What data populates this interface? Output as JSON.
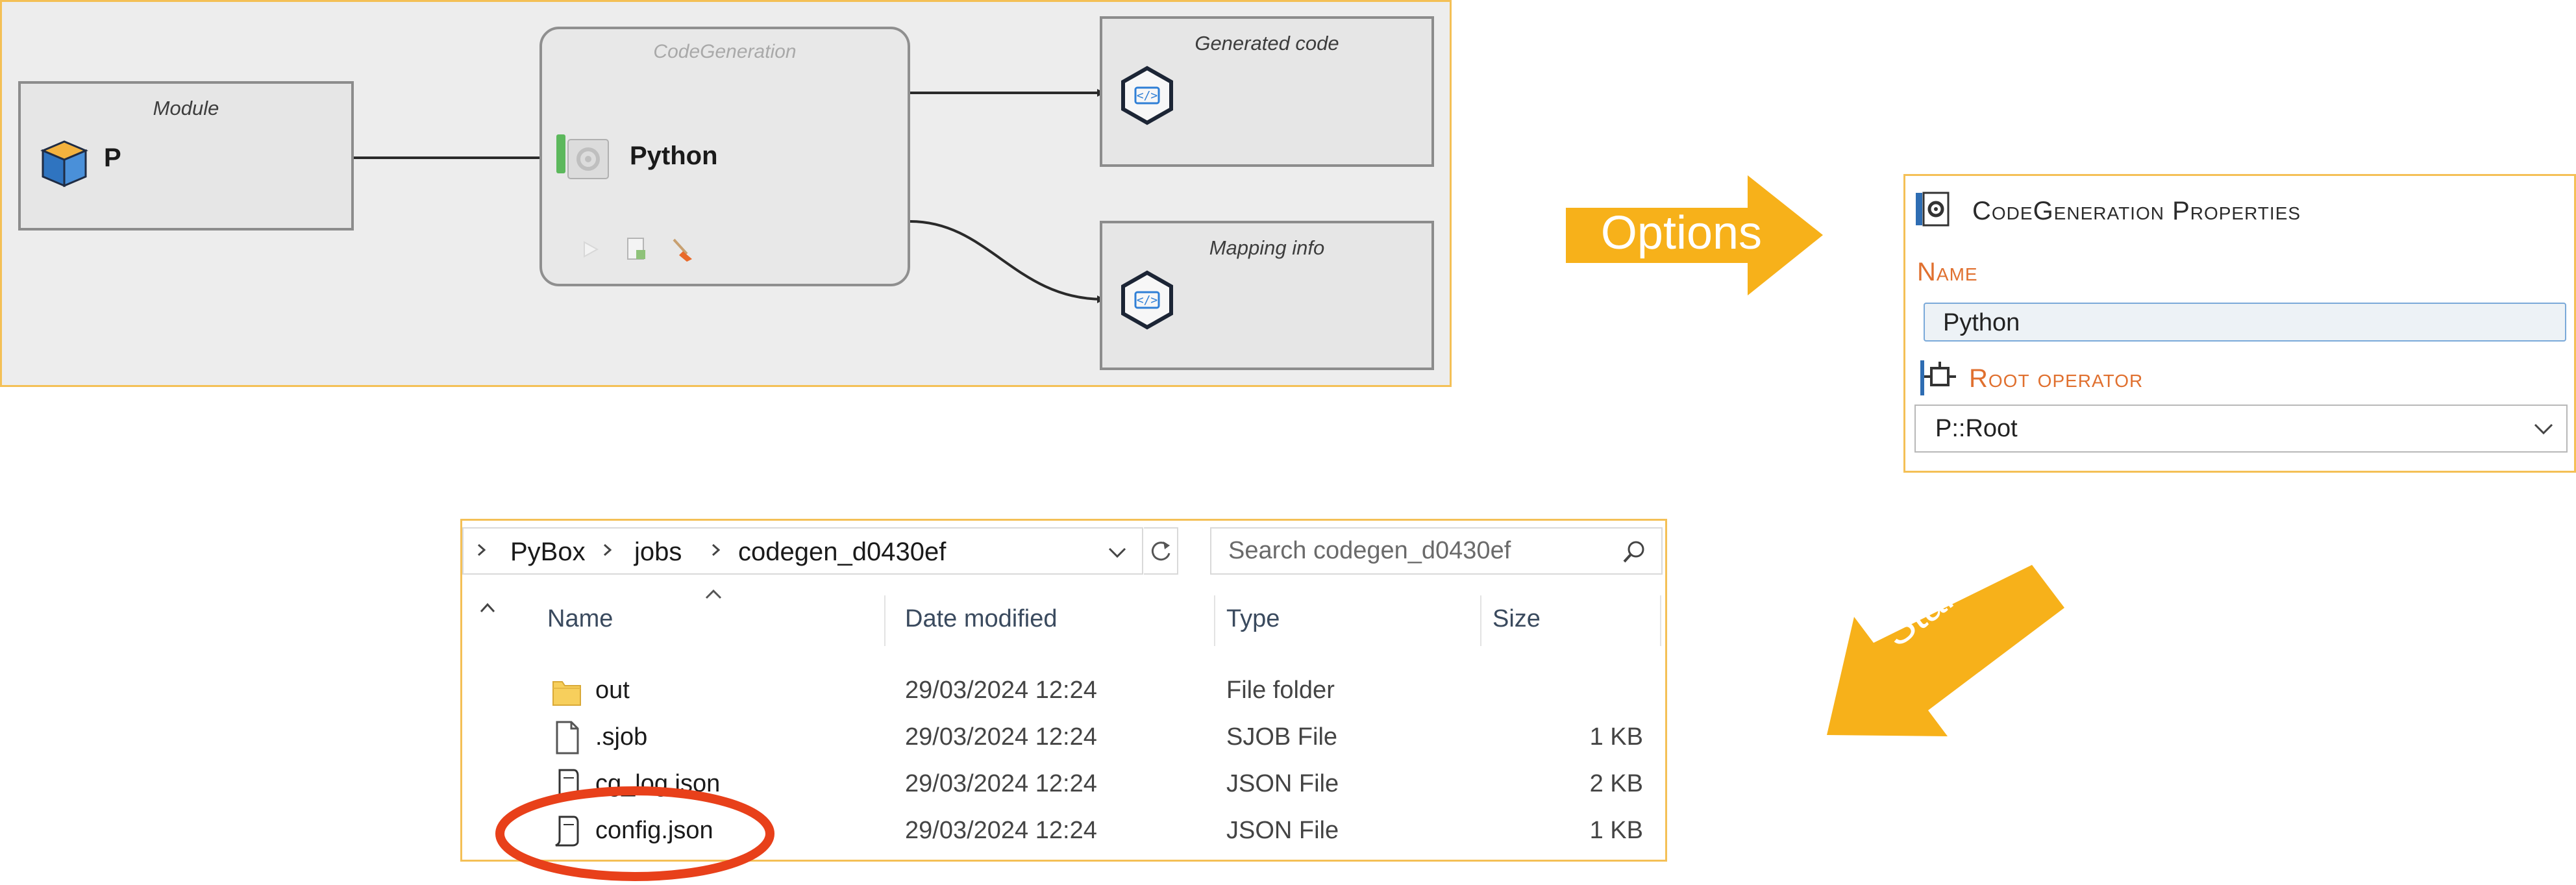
{
  "diagram": {
    "module": {
      "caption": "Module",
      "name": "P"
    },
    "codegen": {
      "caption": "CodeGeneration",
      "name": "Python"
    },
    "generated_code": {
      "caption": "Generated code"
    },
    "mapping_info": {
      "caption": "Mapping info"
    }
  },
  "arrows": {
    "options": {
      "label": "Options",
      "color": "#f7b11a"
    },
    "start": {
      "label": "Start",
      "color": "#f7b11a"
    }
  },
  "properties": {
    "title": "CodeGeneration Properties",
    "name_label": "Name",
    "name_value": "Python",
    "root_operator_label": "Root operator",
    "root_operator_value": "P::Root",
    "label_color": "#e0702f"
  },
  "explorer": {
    "breadcrumbs": [
      "PyBox",
      "jobs",
      "codegen_d0430ef"
    ],
    "search_placeholder": "Search codegen_d0430ef",
    "columns": [
      "Name",
      "Date modified",
      "Type",
      "Size"
    ],
    "files": [
      {
        "name": "out",
        "date": "29/03/2024 12:24",
        "type": "File folder",
        "size": "",
        "icon": "folder-icon"
      },
      {
        "name": ".sjob",
        "date": "29/03/2024 12:24",
        "type": "SJOB File",
        "size": "1 KB",
        "icon": "file-icon"
      },
      {
        "name": "cg_log.json",
        "date": "29/03/2024 12:24",
        "type": "JSON File",
        "size": "2 KB",
        "icon": "json-file-icon"
      },
      {
        "name": "config.json",
        "date": "29/03/2024 12:24",
        "type": "JSON File",
        "size": "1 KB",
        "icon": "json-file-icon"
      }
    ],
    "highlight_color": "#e8401a"
  }
}
